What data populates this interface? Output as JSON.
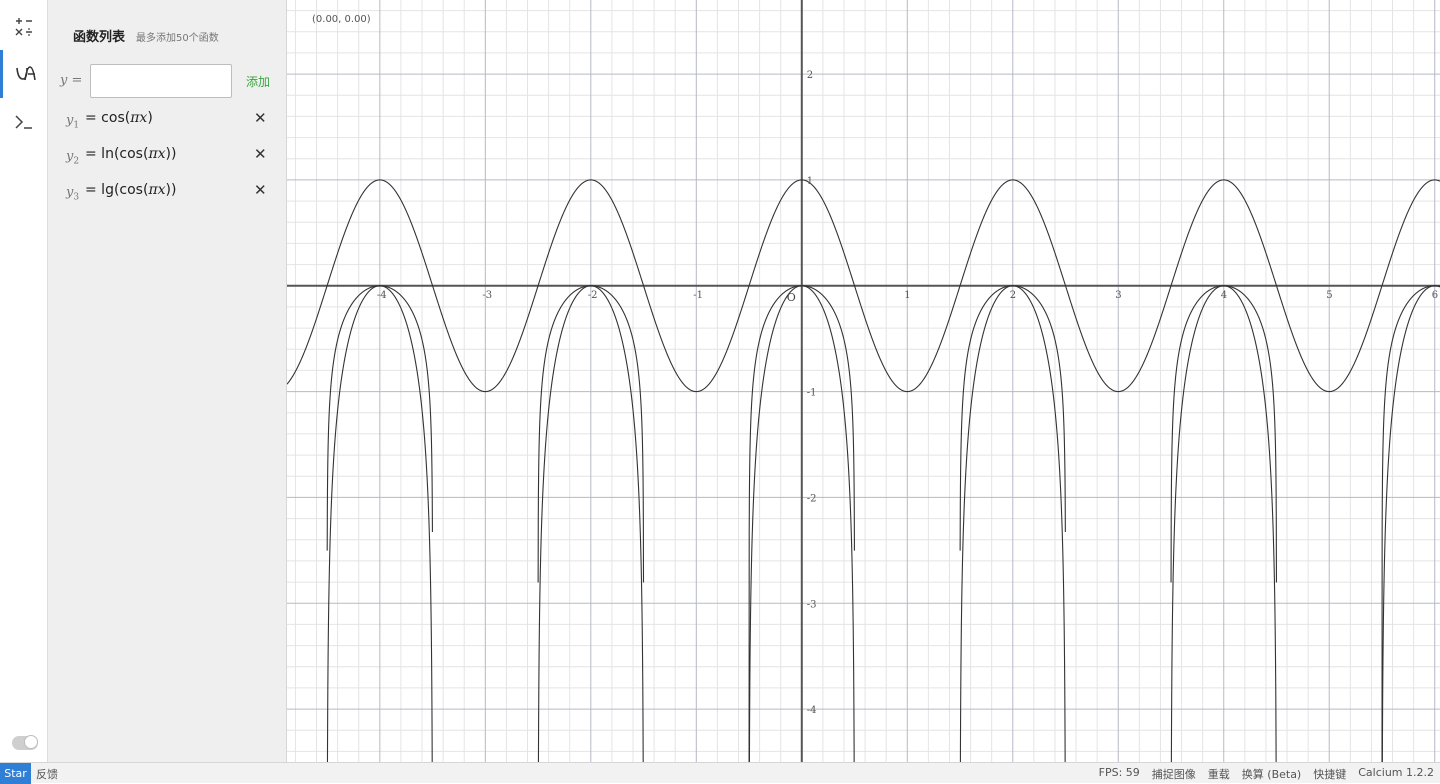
{
  "sidebar": {
    "items": [
      {
        "icon": "calculator-icon",
        "active": false
      },
      {
        "icon": "function-graph-icon",
        "active": true
      },
      {
        "icon": "terminal-icon",
        "active": false
      }
    ],
    "toggle_on": false
  },
  "panel": {
    "title": "函数列表",
    "subtitle": "最多添加50个函数",
    "input_label": "y =",
    "input_value": "",
    "input_placeholder": "",
    "add_label": "添加",
    "functions": [
      {
        "name": "y",
        "index": "1",
        "expr_prefix": "= cos(",
        "expr_math": "πx",
        "expr_suffix": ")"
      },
      {
        "name": "y",
        "index": "2",
        "expr_prefix": "= ln(cos(",
        "expr_math": "πx",
        "expr_suffix": "))"
      },
      {
        "name": "y",
        "index": "3",
        "expr_prefix": "= lg(cos(",
        "expr_math": "πx",
        "expr_suffix": "))"
      }
    ],
    "delete_symbol": "✕"
  },
  "graph": {
    "coord_readout": "(0.00, 0.00)",
    "origin_label": "O",
    "x_ticks": [
      "-4",
      "-3",
      "-2",
      "-1",
      "1",
      "2",
      "3",
      "4",
      "5",
      "6"
    ],
    "y_ticks": [
      "2",
      "1",
      "-1",
      "-2",
      "-3",
      "-4"
    ],
    "xlim": [
      -4.88,
      6.05
    ],
    "ylim": [
      -4.5,
      2.7
    ]
  },
  "statusbar": {
    "star_label": "Star",
    "feedback_label": "反馈",
    "fps": "FPS: 59",
    "capture": "捕捉图像",
    "reload": "重载",
    "convert": "换算 (Beta)",
    "shortcuts": "快捷键",
    "version": "Calcium 1.2.2"
  },
  "colors": {
    "accent": "#2f7fd6",
    "add_green": "#3aa63a",
    "curve": "#333333",
    "major_grid": "#b6b9c7",
    "minor_grid": "#e4e4e4"
  }
}
